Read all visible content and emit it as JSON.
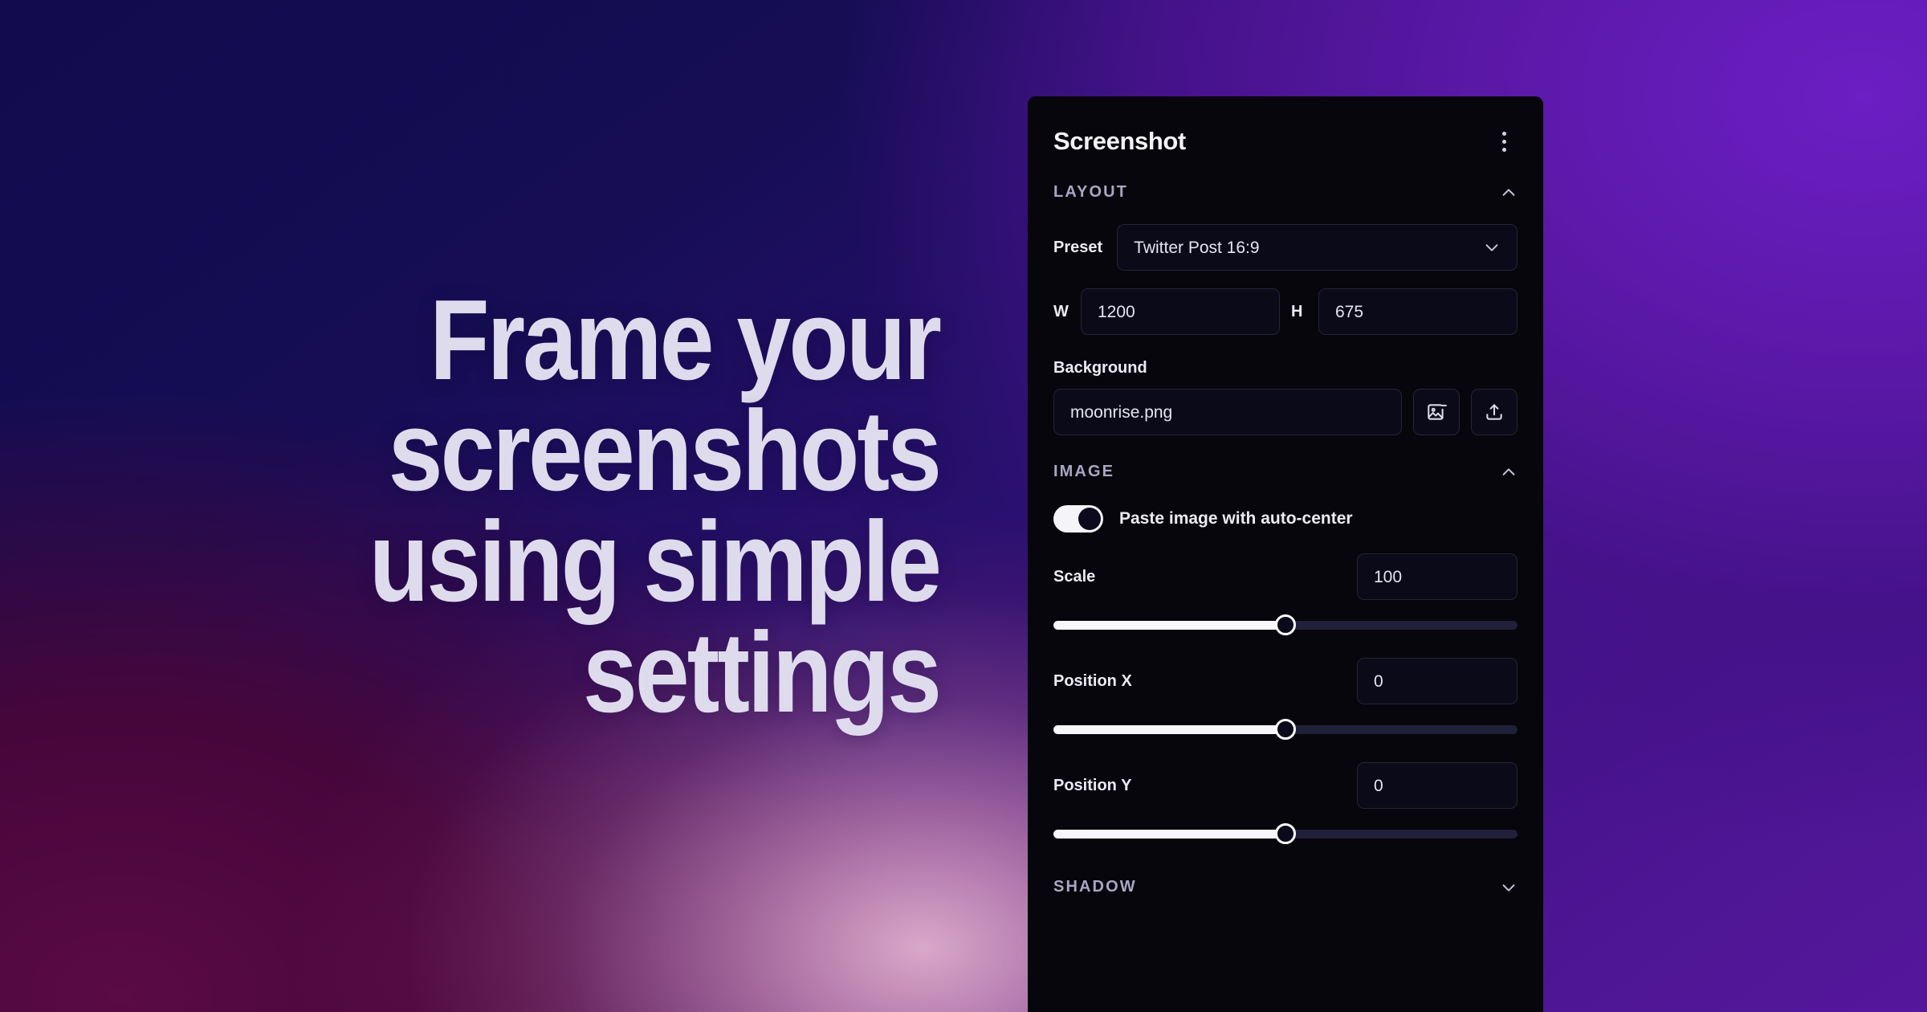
{
  "headline": "Frame your\nscreenshots\nusing simple\nsettings",
  "panel": {
    "title": "Screenshot",
    "menu_icon": "kebab-menu-icon",
    "sections": {
      "layout": {
        "label": "LAYOUT",
        "expanded": true,
        "collapse_icon": "chevron-up-icon",
        "preset": {
          "label": "Preset",
          "value": "Twitter Post 16:9",
          "dropdown_icon": "chevron-down-icon"
        },
        "width": {
          "label": "W",
          "value": "1200"
        },
        "height": {
          "label": "H",
          "value": "675"
        },
        "background": {
          "label": "Background",
          "value": "moonrise.png",
          "remove_icon": "image-remove-icon",
          "upload_icon": "upload-icon"
        }
      },
      "image": {
        "label": "IMAGE",
        "expanded": true,
        "collapse_icon": "chevron-up-icon",
        "auto_center": {
          "label": "Paste image with auto-center",
          "enabled": true
        },
        "scale": {
          "label": "Scale",
          "value": "100",
          "slider_percent": 50
        },
        "position_x": {
          "label": "Position X",
          "value": "0",
          "slider_percent": 50
        },
        "position_y": {
          "label": "Position Y",
          "value": "0",
          "slider_percent": 50
        }
      },
      "shadow": {
        "label": "SHADOW",
        "expanded": false,
        "collapse_icon": "chevron-down-icon"
      }
    }
  },
  "colors": {
    "panel_background": "#07060c",
    "field_background": "#0b0a19",
    "field_border": "#262338",
    "accent_text": "#a9a6c4",
    "headline_text": "#dedbed",
    "slider_fill": "#f7f6fb",
    "slider_track": "#20203a",
    "bg_navy": "#120c4d",
    "bg_purple": "#5a18a6",
    "bg_magenta": "#5a0a45",
    "bg_pink_glow": "#e2b0cd"
  }
}
